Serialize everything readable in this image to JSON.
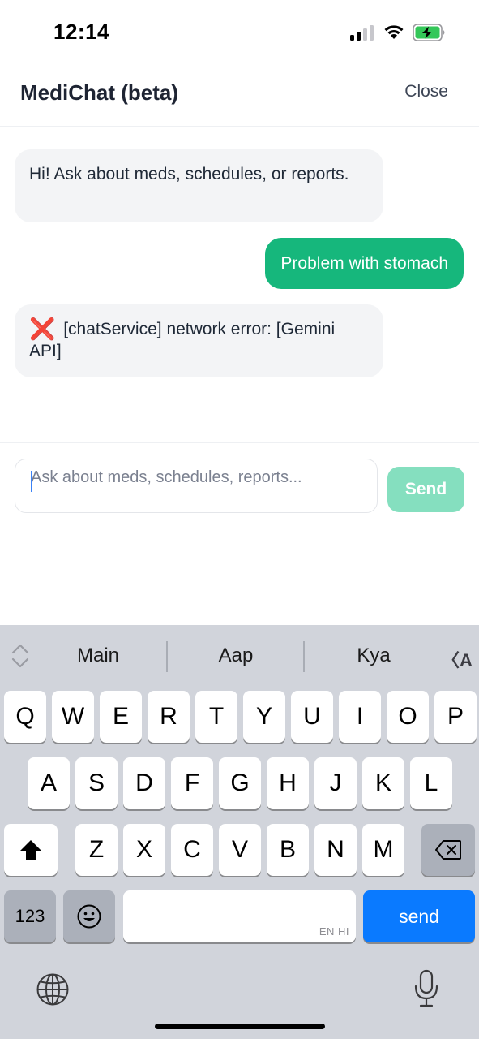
{
  "status_bar": {
    "time": "12:14",
    "icons": [
      "cellular-signal-icon",
      "wifi-icon",
      "battery-charging-icon"
    ],
    "battery_color": "#34c759"
  },
  "header": {
    "title": "MediChat (beta)",
    "close_label": "Close"
  },
  "messages": [
    {
      "role": "bot",
      "text": "Hi! Ask about meds, schedules, or reports."
    },
    {
      "role": "user",
      "text": "Problem with stomach"
    },
    {
      "role": "bot",
      "icon": "cross-mark-icon",
      "icon_glyph": "❌",
      "text": "[chatService] network error: [Gemini API]"
    }
  ],
  "input": {
    "value": "",
    "placeholder": "Ask about meds, schedules, reports...",
    "send_label": "Send"
  },
  "keyboard": {
    "suggestions": [
      "Main",
      "Aap",
      "Kya"
    ],
    "translate_glyph": "〈A",
    "row1": [
      "Q",
      "W",
      "E",
      "R",
      "T",
      "Y",
      "U",
      "I",
      "O",
      "P"
    ],
    "row2": [
      "A",
      "S",
      "D",
      "F",
      "G",
      "H",
      "J",
      "K",
      "L"
    ],
    "row3": [
      "Z",
      "X",
      "C",
      "V",
      "B",
      "N",
      "M"
    ],
    "numbers_label": "123",
    "space_languages": "EN HI",
    "return_label": "send"
  },
  "colors": {
    "accent": "#16b77c",
    "send_disabled": "#85dfbf",
    "keyboard_return": "#0a7aff",
    "error_icon": "#e01b24"
  }
}
